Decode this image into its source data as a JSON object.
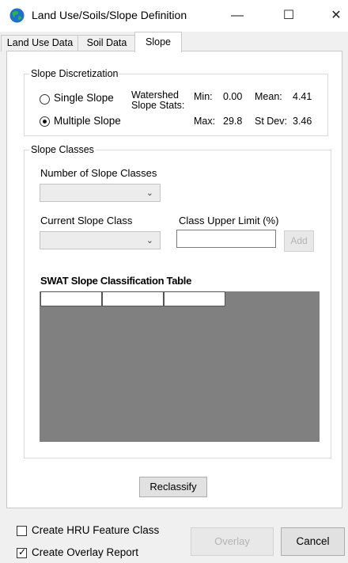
{
  "window": {
    "title": "Land Use/Soils/Slope Definition",
    "minimize_glyph": "—",
    "maximize_glyph": "☐",
    "close_glyph": "✕",
    "icon": "globe-icon"
  },
  "tabs": [
    {
      "label": "Land Use Data"
    },
    {
      "label": "Soil Data"
    },
    {
      "label": "Slope",
      "active": true
    }
  ],
  "slope_discretization": {
    "title": "Slope Discretization",
    "options": [
      {
        "label": "Single Slope",
        "selected": false
      },
      {
        "label": "Multiple Slope",
        "selected": true
      }
    ],
    "stats_label_1": "Watershed",
    "stats_label_2": "Slope Stats:",
    "min_label": "Min:",
    "min_value": "0.00",
    "max_label": "Max:",
    "max_value": "29.8",
    "mean_label": "Mean:",
    "mean_value": "4.41",
    "stdev_label": "St Dev:",
    "stdev_value": "3.46"
  },
  "slope_classes": {
    "title": "Slope Classes",
    "number_label": "Number of Slope Classes",
    "number_value": "",
    "current_label": "Current Slope Class",
    "current_value": "",
    "upper_limit_label": "Class Upper Limit (%)",
    "upper_limit_value": "",
    "add_label": "Add",
    "table_title": "SWAT Slope Classification Table"
  },
  "reclassify_label": "Reclassify",
  "footer": {
    "create_hru_label": "Create HRU Feature Class",
    "create_hru_checked": false,
    "create_overlay_label": "Create Overlay Report",
    "create_overlay_checked": true,
    "overlay_label": "Overlay",
    "cancel_label": "Cancel"
  }
}
